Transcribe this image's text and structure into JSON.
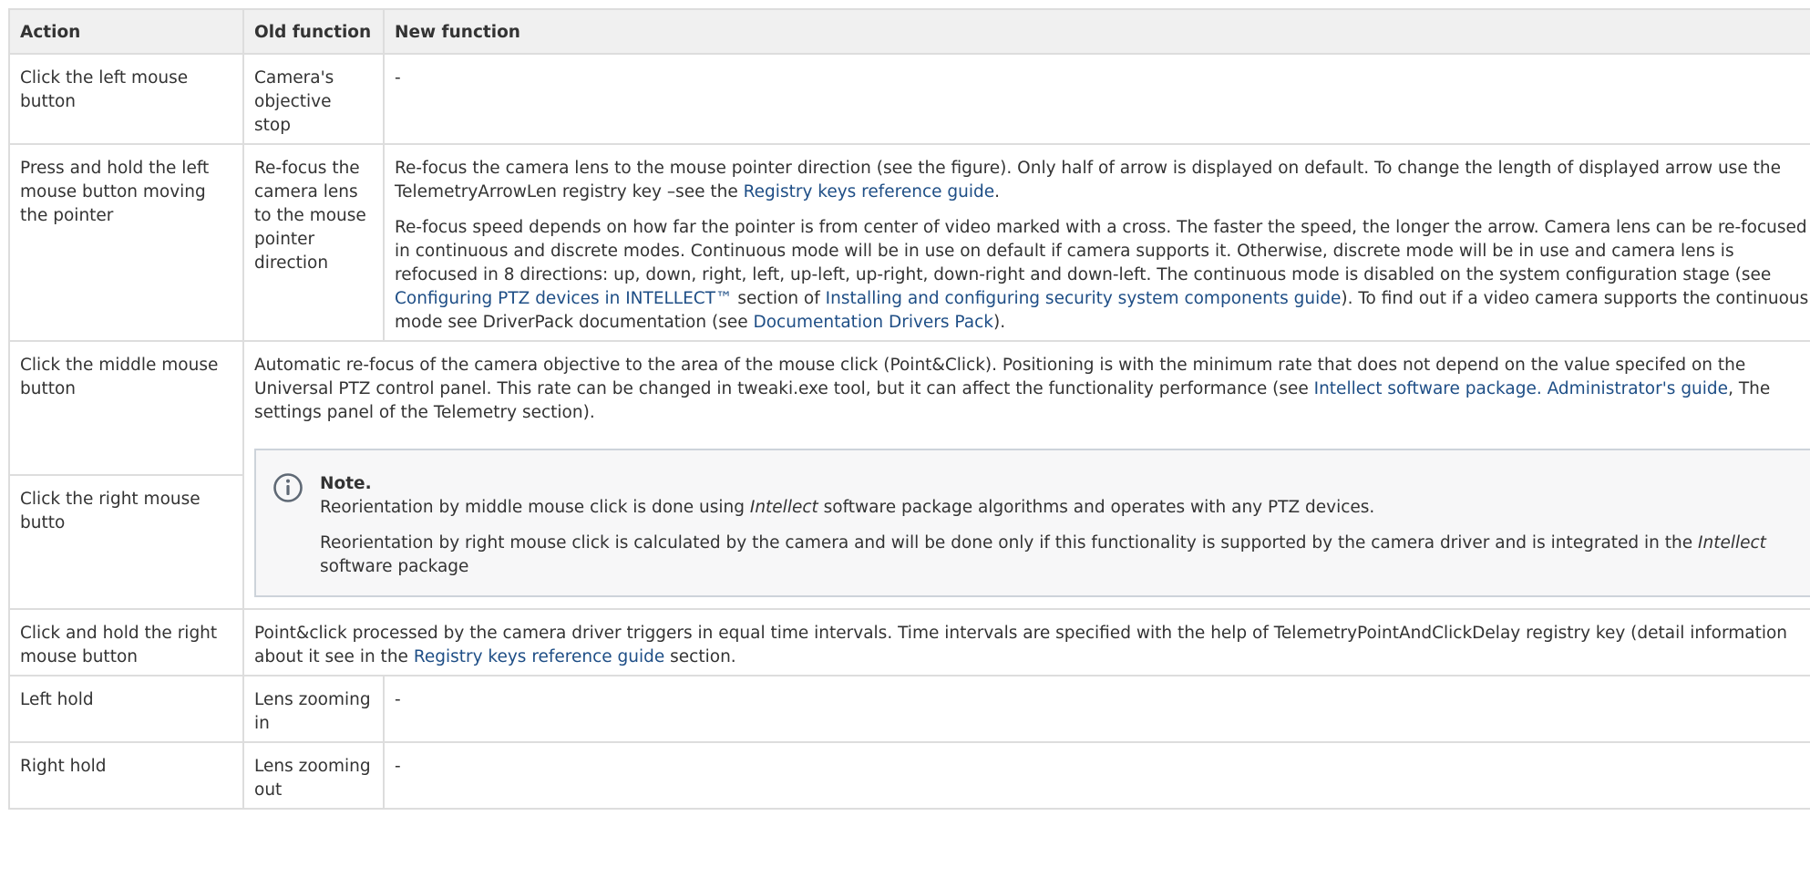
{
  "colors": {
    "link": "#1e4e86",
    "header_bg": "#f0f0f0",
    "border": "#dddddd",
    "note_bg": "#f7f7f8",
    "note_border": "#cdd3da",
    "text": "#333333"
  },
  "headers": {
    "action": "Action",
    "old": "Old function",
    "new": "New function"
  },
  "rows": [
    {
      "action": "Click the left mouse button",
      "old": "Camera's objective stop",
      "new": "-"
    },
    {
      "action": "Press and hold the left mouse button moving the pointer",
      "old": "Re-focus the camera lens to the mouse pointer direction",
      "p1_text": "Re-focus the camera lens to the mouse pointer direction (see the figure). Only half of arrow is displayed on default. To change the length of displayed arrow use the TelemetryArrowLen registry key –see the ",
      "p1_link": "Registry keys reference guide",
      "p1_end": ".",
      "p2_text": "Re-focus speed depends on how far the pointer is from center of video marked with a cross. The faster the speed, the longer the arrow. Camera lens can be re-focused in continuous and discrete modes. Continuous mode will be in use on default if camera supports it. Otherwise, discrete mode will be in use and camera lens is refocused in 8 directions: up, down, right, left, up-left, up-right, down-right and down-left. The continuous mode is disabled on the system configuration stage (see ",
      "p2_link1": "Configuring PTZ devices in INTELLECT™",
      "p2_mid1": " section of ",
      "p2_link2": "Installing and configuring security system components guide",
      "p2_mid2": "). To find out if a video camera supports the continuous mode see DriverPack documentation (see ",
      "p2_link3": "Documentation Drivers Pack",
      "p2_end": ")."
    },
    {
      "action": "Click the middle mouse button",
      "text": "Automatic re-focus of the camera objective to the area of the mouse click (Point&Click). Positioning is with the minimum rate that does not depend on the value specifed on the Universal PTZ control panel. This rate can be changed in tweaki.exe tool, but it can affect the functionality performance (see ",
      "link": "Intellect software package. Administrator's guide",
      "text_end": ", The settings panel of the Telemetry section).",
      "note": {
        "title": "Note.",
        "p1_a": "Reorientation by middle mouse click is done using ",
        "p1_em": "Intellect",
        "p1_b": " software package algorithms and operates with any PTZ devices.",
        "p2_a": "Reorientation by right mouse click is calculated by the camera and will be done only if this functionality is supported by the camera driver and is integrated in the ",
        "p2_em": "Intellect",
        "p2_b": " software package"
      }
    },
    {
      "action": "Click the right mouse butto"
    },
    {
      "action": "Click and hold the right mouse button",
      "text": "Point&click processed by the camera driver triggers in equal time intervals. Time intervals are specified with the help of TelemetryPointAndClickDelay registry key (detail information about it see in the ",
      "link": "Registry keys reference guide",
      "text_end": " section."
    },
    {
      "action": "Left hold",
      "old": "Lens zooming in",
      "new": "-"
    },
    {
      "action": "Right hold",
      "old": "Lens zooming out",
      "new": "-"
    }
  ]
}
